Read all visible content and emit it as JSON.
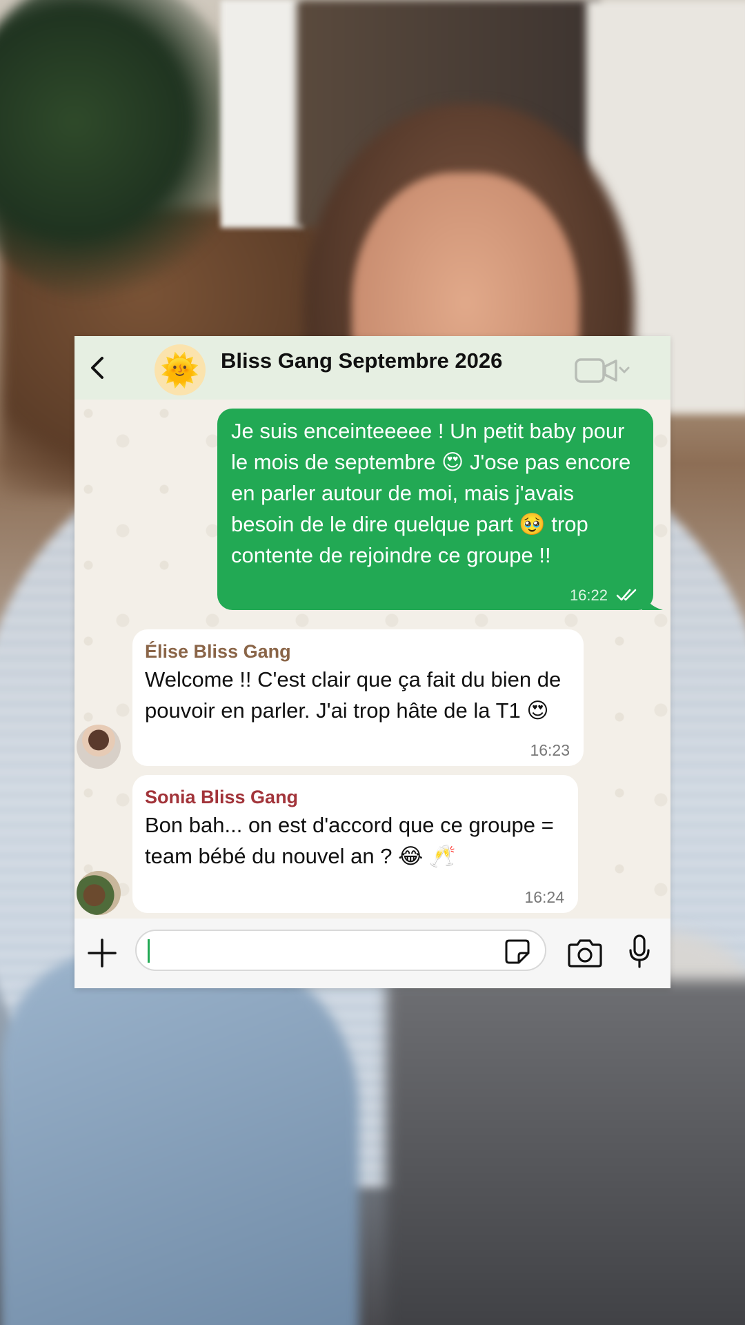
{
  "chat": {
    "title": "Bliss Gang Septembre 2026",
    "group_avatar_emoji": "🌞",
    "icons": {
      "back": "chevron-left-icon",
      "video": "video-camera-icon",
      "plus": "plus-icon",
      "sticker": "sticker-icon",
      "camera": "camera-icon",
      "mic": "microphone-icon",
      "read": "double-check-icon"
    }
  },
  "messages": {
    "outgoing": {
      "text": "Je suis enceinteeeee ! Un petit baby pour le mois de septembre 😍 J'ose pas encore en parler autour de moi, mais j'avais besoin de le dire quelque part 🥹 trop contente de rejoindre ce groupe !!",
      "time": "16:22",
      "status": "read"
    },
    "incoming": [
      {
        "sender": "Élise Bliss Gang",
        "sender_color": "#8a6548",
        "text": "Welcome !! C'est clair que ça fait du bien de pouvoir en parler. J'ai trop hâte de la T1 😍",
        "time": "16:23"
      },
      {
        "sender": "Sonia Bliss Gang",
        "sender_color": "#a2343a",
        "text": "Bon bah... on est d'accord que ce groupe = team bébé du nouvel an ? 😂 🥂",
        "time": "16:24"
      }
    ]
  },
  "composer": {
    "value": ""
  },
  "colors": {
    "outgoing_bubble": "#22a954",
    "header_bg": "#e6efe2",
    "chat_bg": "#f3efe8"
  }
}
